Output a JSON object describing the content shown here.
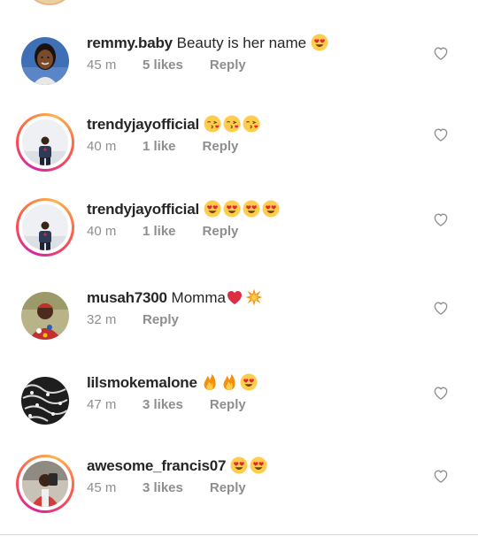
{
  "comments": [
    {
      "username": "remmy.baby",
      "text": "Beauty is her name",
      "emojis": [
        "heart-eyes"
      ],
      "time": "45 m",
      "likes": "5 likes",
      "reply": "Reply",
      "avatar": "woman-portrait",
      "ring": false
    },
    {
      "username": "trendyjayofficial",
      "text": "",
      "emojis": [
        "kissing-heart",
        "kissing-heart",
        "kissing-heart"
      ],
      "time": "40 m",
      "likes": "1 like",
      "reply": "Reply",
      "avatar": "man-blue-shirt",
      "ring": true
    },
    {
      "username": "trendyjayofficial",
      "text": "",
      "emojis": [
        "heart-eyes",
        "heart-eyes",
        "heart-eyes",
        "heart-eyes"
      ],
      "time": "40 m",
      "likes": "1 like",
      "reply": "Reply",
      "avatar": "man-blue-shirt",
      "ring": true
    },
    {
      "username": "musah7300",
      "text": "Momma",
      "emojis": [
        "red-heart",
        "collision"
      ],
      "time": "32 m",
      "likes": "",
      "reply": "Reply",
      "avatar": "man-patterned-shirt",
      "ring": false
    },
    {
      "username": "lilsmokemalone",
      "text": "",
      "emojis": [
        "fire",
        "fire",
        "heart-eyes"
      ],
      "time": "47 m",
      "likes": "3 likes",
      "reply": "Reply",
      "avatar": "silver-chain-jewelry",
      "ring": false
    },
    {
      "username": "awesome_francis07",
      "text": "",
      "emojis": [
        "heart-eyes",
        "heart-eyes"
      ],
      "time": "45 m",
      "likes": "3 likes",
      "reply": "Reply",
      "avatar": "man-red-outfit",
      "ring": true
    }
  ],
  "colors": {
    "text": "#262626",
    "muted": "#8e8e8e",
    "divider": "#dbdbdb",
    "story_ring": [
      "#d6249f",
      "#fd5949",
      "#fdb34b"
    ]
  },
  "icons": {
    "like": "heart-outline-icon"
  }
}
